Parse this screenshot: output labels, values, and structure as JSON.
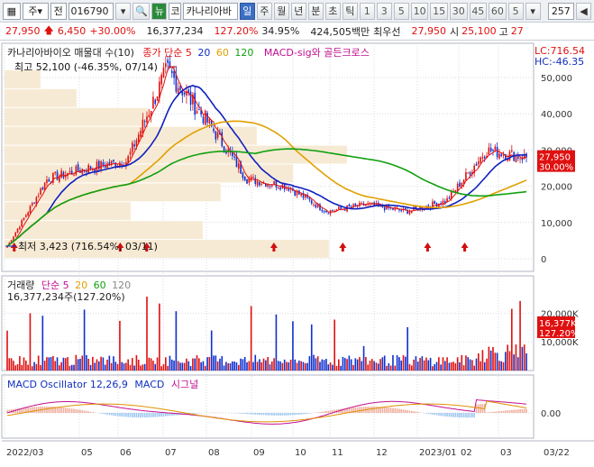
{
  "toolbar": {
    "market": "주",
    "mode": "전",
    "code": "016790",
    "name_tag": "코",
    "name": "카나리아바",
    "periods": [
      "일",
      "주",
      "월",
      "년",
      "분",
      "초",
      "틱"
    ],
    "active_period": "일",
    "intervals": [
      "1",
      "3",
      "5",
      "10",
      "15",
      "30",
      "45",
      "60",
      "5"
    ],
    "count": "257"
  },
  "info": {
    "price": "27,950",
    "change": "6,450",
    "change_pct": "+30.00%",
    "volume": "16,377,234",
    "vol_ratio": "127.20%",
    "turnover": "34.95%",
    "amount": "424,505백만",
    "quote_label": "최우선",
    "bid": "27,950",
    "bid_label": "시",
    "open": "25,100",
    "high_label": "고",
    "high": "27"
  },
  "price_panel": {
    "title": "카나리아바이오 매물대 수(10)",
    "ma_label": "종가 단순",
    "ma_periods": [
      "5",
      "20",
      "60",
      "120"
    ],
    "ma_colors": [
      "#e01010",
      "#1020c0",
      "#e0a000",
      "#10a010"
    ],
    "signal_label": "MACD-sig와 골든크로스",
    "lc": "LC:716.54",
    "hc": "HC:-46.35",
    "high_note": "최고 52,100 (-46.35%, 07/14)",
    "low_note": "최저 3,423 (716.54%, 03/11)",
    "yticks": [
      "50,000",
      "40,000",
      "30,000",
      "20,000",
      "10,000",
      "0"
    ],
    "current_price": "27,950",
    "current_pct": "30.00%"
  },
  "volume_panel": {
    "title": "거래량",
    "ma_label": "단순",
    "ma_periods": [
      "5",
      "20",
      "60",
      "120"
    ],
    "value": "16,377,234주(127.20%)",
    "yticks": [
      "20,000K",
      "10,000K"
    ],
    "current": "16,377K",
    "current_pct": "127.20%"
  },
  "macd_panel": {
    "title": "MACD Oscillator 12,26,9",
    "macd_label": "MACD",
    "signal_label": "시그널",
    "ytick": "0.00"
  },
  "xaxis": [
    "2022/03",
    "05",
    "06",
    "07",
    "08",
    "09",
    "10",
    "11",
    "12",
    "2023/01",
    "02",
    "03",
    "03/22"
  ],
  "chart_data": {
    "type": "candlestick",
    "title": "카나리아바이오 매물대 수(10)",
    "x_range": [
      "2022/03",
      "2023/03/22"
    ],
    "ylim": [
      0,
      55000
    ],
    "close_series_approx": [
      {
        "x": "2022/03",
        "y": 3423
      },
      {
        "x": "2022/04",
        "y": 22000
      },
      {
        "x": "2022/05",
        "y": 25000
      },
      {
        "x": "2022/06",
        "y": 27000
      },
      {
        "x": "2022/07",
        "y": 52100
      },
      {
        "x": "2022/08",
        "y": 38000
      },
      {
        "x": "2022/09",
        "y": 22000
      },
      {
        "x": "2022/10",
        "y": 20000
      },
      {
        "x": "2022/11",
        "y": 13000
      },
      {
        "x": "2022/12",
        "y": 15000
      },
      {
        "x": "2023/01",
        "y": 13000
      },
      {
        "x": "2023/02",
        "y": 16000
      },
      {
        "x": "2023/03",
        "y": 30000
      },
      {
        "x": "2023/03/22",
        "y": 27950
      }
    ],
    "legend": [
      "종가 단순 5",
      "20",
      "60",
      "120"
    ]
  }
}
